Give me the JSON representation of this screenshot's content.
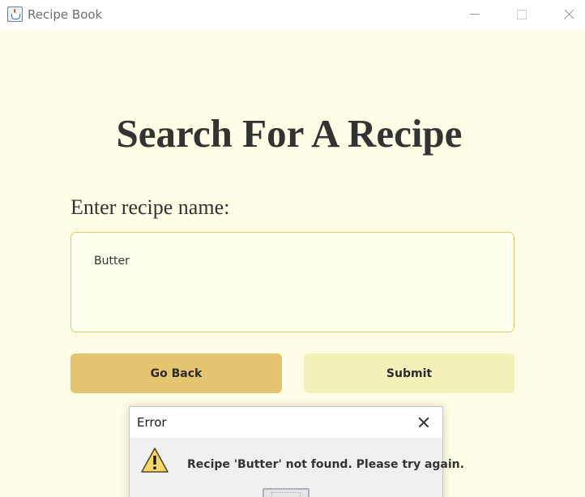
{
  "window": {
    "title": "Recipe Book",
    "icon": "java-cup-icon"
  },
  "page": {
    "title": "Search For A Recipe",
    "field_label": "Enter recipe name:",
    "search_value": "Butter",
    "back_label": "Go Back",
    "submit_label": "Submit"
  },
  "dialog": {
    "title": "Error",
    "icon": "warning-icon",
    "message": "Recipe 'Butter' not found. Please try again.",
    "ok_label": ""
  },
  "colors": {
    "background": "#fffde6",
    "go_back_button": "#e4c46e",
    "submit_button": "#f1f1b8",
    "input_border": "#e4c36b",
    "text": "#333333"
  }
}
